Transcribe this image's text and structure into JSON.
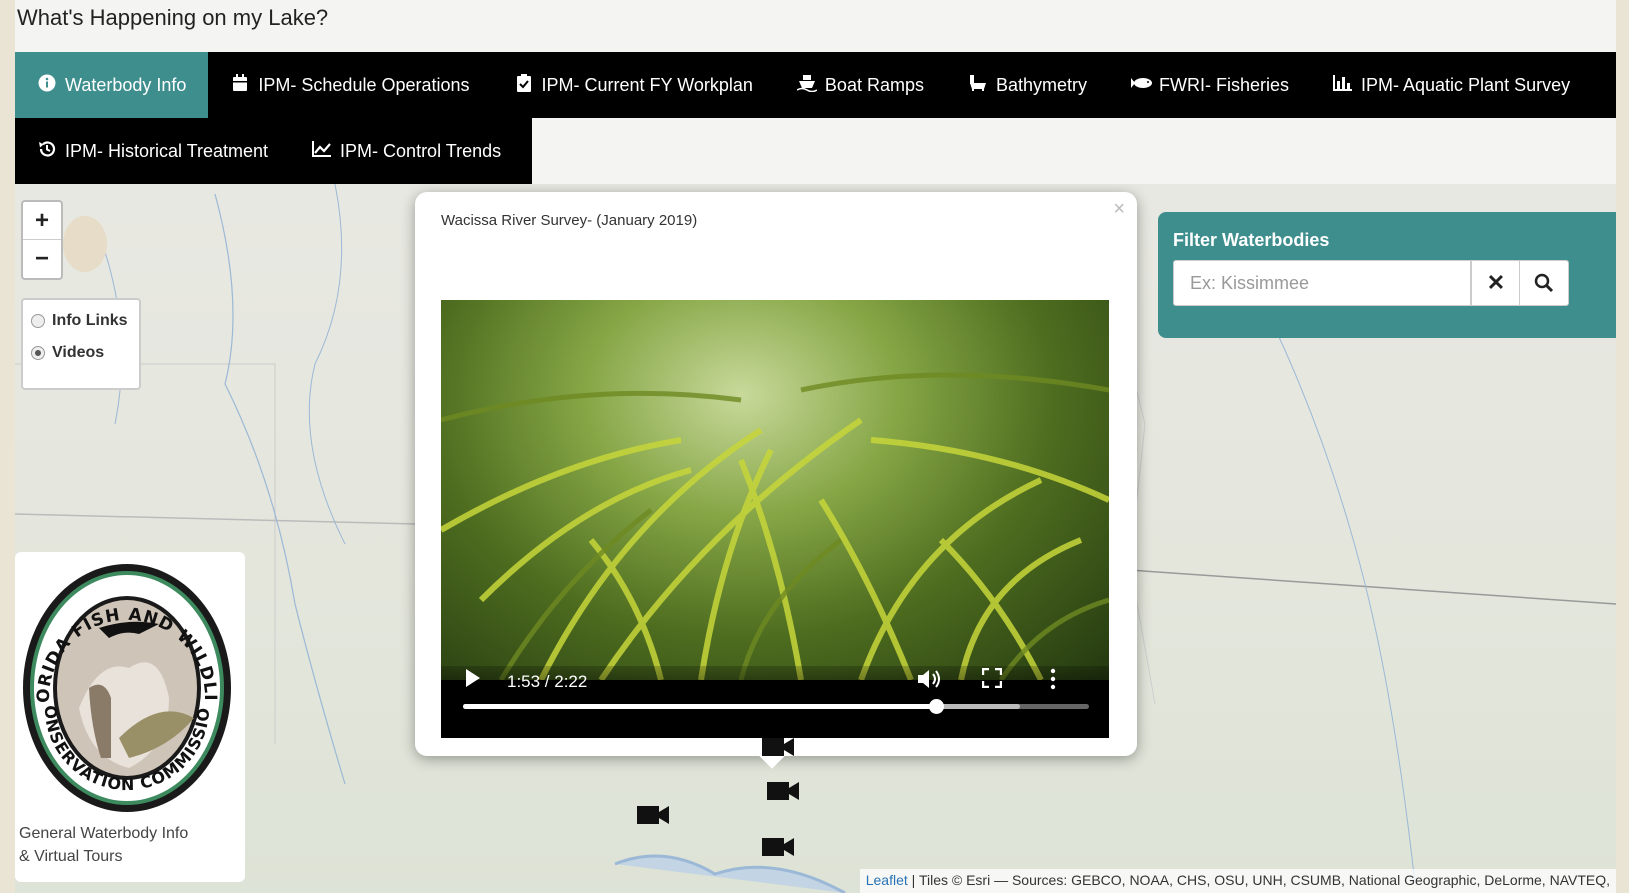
{
  "app": {
    "title": "What's Happening on my Lake?"
  },
  "nav": {
    "row1": [
      {
        "label": "Waterbody Info",
        "icon": "info-circle-icon",
        "active": true
      },
      {
        "label": "IPM- Schedule Operations",
        "icon": "calendar-icon"
      },
      {
        "label": "IPM- Current FY Workplan",
        "icon": "clipboard-check-icon"
      },
      {
        "label": "Boat Ramps",
        "icon": "ship-icon"
      },
      {
        "label": "Bathymetry",
        "icon": "bathtub-icon"
      },
      {
        "label": "FWRI- Fisheries",
        "icon": "fish-icon"
      },
      {
        "label": "IPM- Aquatic Plant Survey",
        "icon": "bar-chart-icon"
      }
    ],
    "row2": [
      {
        "label": "IPM- Historical Treatment",
        "icon": "history-icon"
      },
      {
        "label": "IPM- Control Trends",
        "icon": "line-chart-icon"
      }
    ]
  },
  "map": {
    "zoom": {
      "in": "+",
      "out": "−"
    },
    "layers": [
      {
        "label": "Info Links",
        "selected": false
      },
      {
        "label": "Videos",
        "selected": true
      }
    ],
    "logo": {
      "text_top": "FLORIDA FISH AND WILDLIFE",
      "text_bottom": "CONSERVATION COMMISSION",
      "caption_line1": "General Waterbody Info",
      "caption_line2": "& Virtual Tours"
    },
    "filter": {
      "title": "Filter Waterbodies",
      "placeholder": "Ex: Kissimmee",
      "clear": "✕",
      "search_icon": "search-icon"
    },
    "attribution": {
      "leaflet": "Leaflet",
      "text": "| Tiles © Esri — Sources: GEBCO, NOAA, CHS, OSU, UNH, CSUMB, National Geographic, DeLorme, NAVTEQ,"
    }
  },
  "popup": {
    "title": "Wacissa River Survey- (January 2019)",
    "close": "×",
    "video": {
      "time": "1:53 / 2:22",
      "progress": 0.755,
      "buffered": 0.89
    }
  },
  "colors": {
    "accent": "#3f8e8e",
    "nav_bg": "#000000"
  }
}
